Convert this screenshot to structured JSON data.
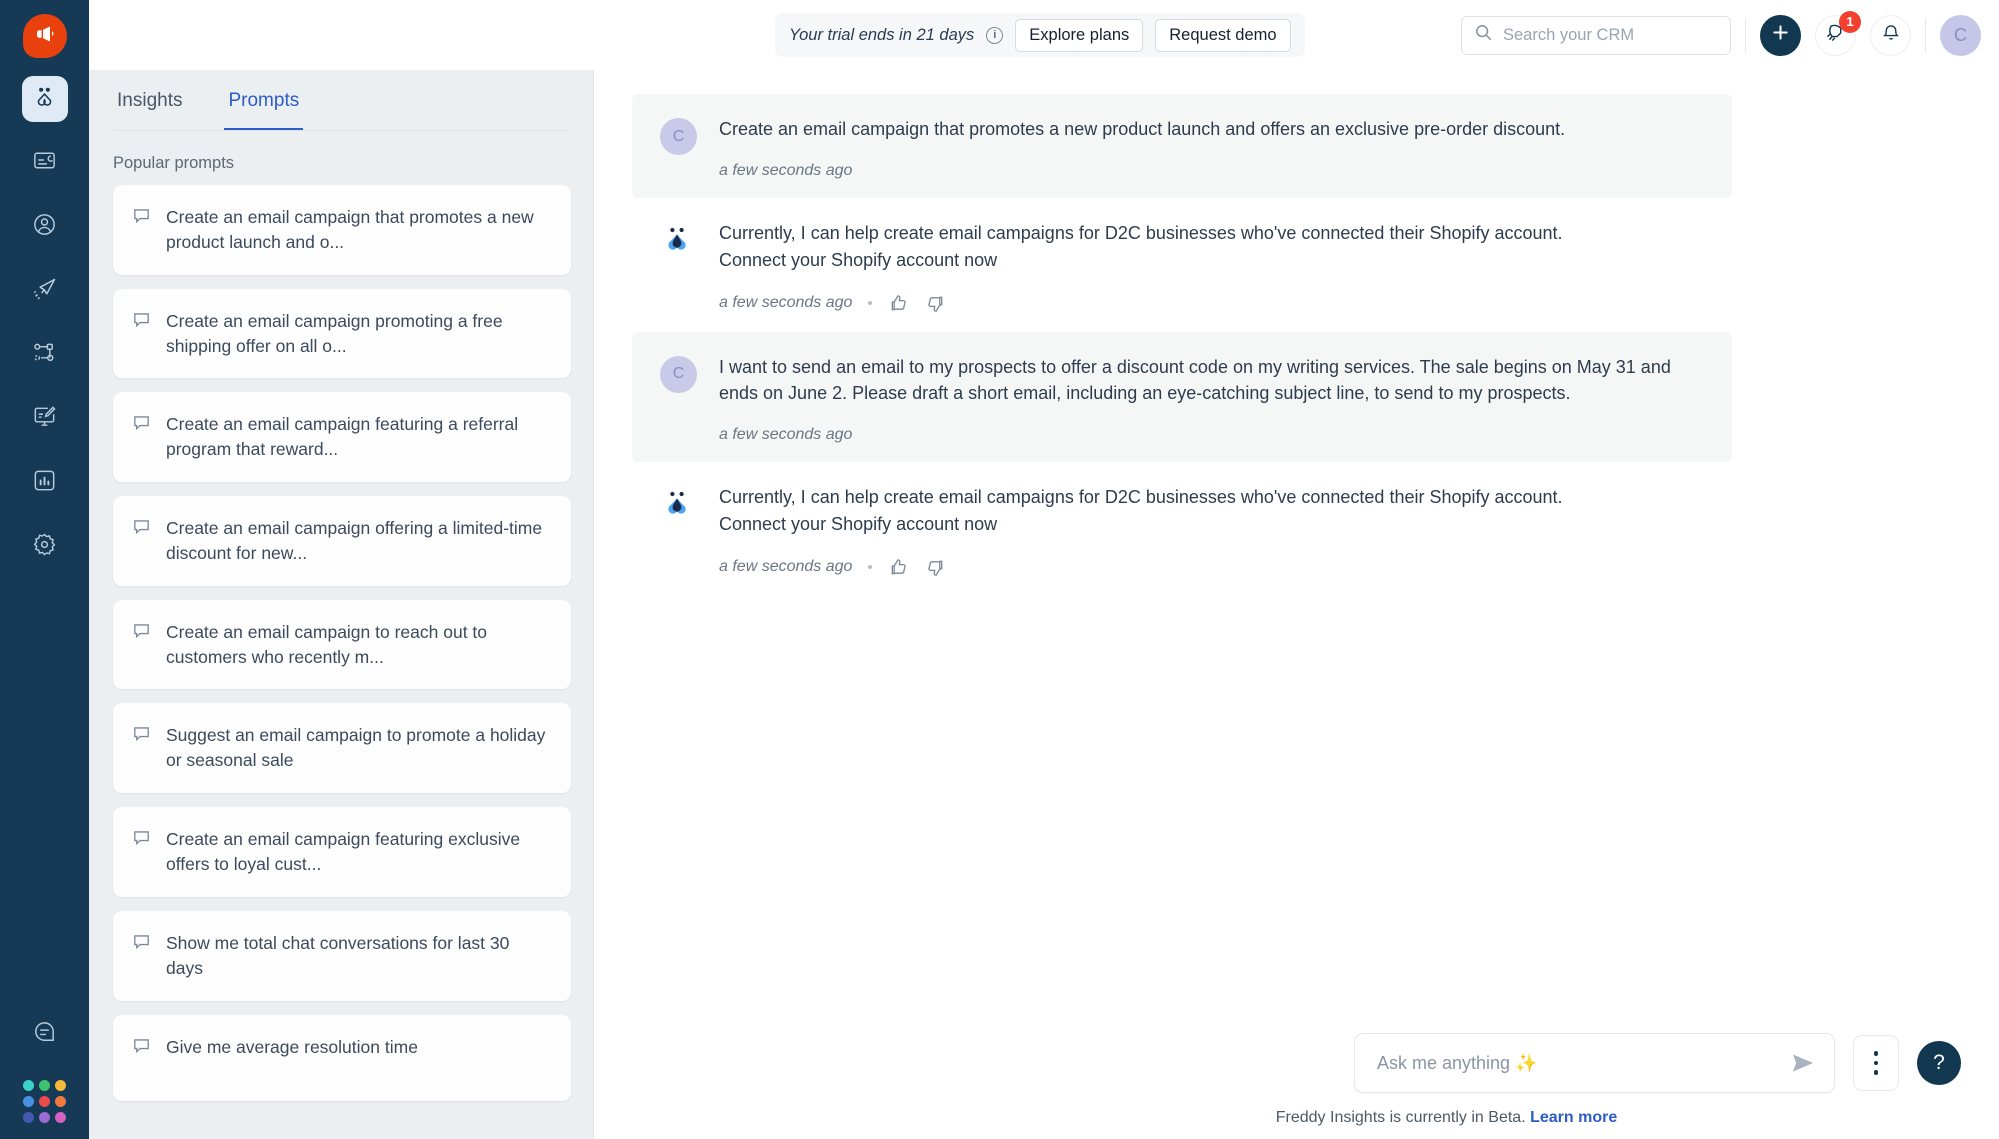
{
  "rail": {
    "logo_icon": "freshworks-megaphone-logo",
    "items": [
      {
        "name": "freddy-ai",
        "icon": "freddy-bot-icon",
        "active": true
      },
      {
        "name": "inbox",
        "icon": "card-inbox-icon",
        "active": false
      },
      {
        "name": "contacts",
        "icon": "person-circle-icon",
        "active": false
      },
      {
        "name": "campaigns",
        "icon": "paper-plane-icon",
        "active": false
      },
      {
        "name": "workflows",
        "icon": "workflow-nodes-icon",
        "active": false
      },
      {
        "name": "web-forms",
        "icon": "monitor-pencil-icon",
        "active": false
      },
      {
        "name": "reports",
        "icon": "bar-chart-icon",
        "active": false
      },
      {
        "name": "settings",
        "icon": "gear-icon",
        "active": false
      }
    ],
    "bottom": [
      {
        "name": "chat-support",
        "icon": "chat-bubble-icon"
      },
      {
        "name": "app-switcher",
        "icon": "dot-grid-icon"
      }
    ],
    "dot_colors": [
      "#3ad5c6",
      "#3fc26b",
      "#f6b93b",
      "#4a90e2",
      "#ec4b4b",
      "#f0793c",
      "#4558b0",
      "#9b6bd6",
      "#d561c0"
    ]
  },
  "header": {
    "trial_text": "Your trial ends in 21 days",
    "info_icon": "info-icon",
    "explore_plans_label": "Explore plans",
    "request_demo_label": "Request demo",
    "search": {
      "placeholder": "Search your CRM",
      "value": "",
      "icon": "search-icon"
    },
    "add_icon": "plus-icon",
    "launch_icon": "rocket-icon",
    "launch_badge": "1",
    "notifications_icon": "bell-icon",
    "avatar_initial": "C"
  },
  "panel": {
    "tabs": [
      {
        "label": "Insights",
        "active": false
      },
      {
        "label": "Prompts",
        "active": true
      }
    ],
    "section_title": "Popular prompts",
    "card_icon": "chat-bubble-icon",
    "prompts": [
      "Create an email campaign that promotes a new product launch and o...",
      "Create an email campaign promoting a free shipping offer on all o...",
      "Create an email campaign featuring a referral program that reward...",
      "Create an email campaign offering a limited-time discount for new...",
      "Create an email campaign to reach out to customers who recently m...",
      "Suggest an email campaign to promote a holiday or seasonal sale",
      "Create an email campaign featuring exclusive offers to loyal cust...",
      "Show me total chat conversations for last 30 days",
      "Give me average resolution time"
    ]
  },
  "chat": {
    "messages": [
      {
        "role": "user",
        "avatar_initial": "C",
        "text": "Create an email campaign that promotes a new product launch and offers an exclusive pre-order discount.",
        "time": "a few seconds ago",
        "has_reactions": false
      },
      {
        "role": "bot",
        "avatar_icon": "freddy-bot-icon",
        "text": "Currently, I can help create email campaigns for D2C businesses who've connected their Shopify account. Connect your Shopify account now",
        "time": "a few seconds ago",
        "has_reactions": true,
        "thumbs_up_icon": "thumbs-up-icon",
        "thumbs_down_icon": "thumbs-down-icon"
      },
      {
        "role": "user",
        "avatar_initial": "C",
        "text": "I want to send an email to my prospects to offer a discount code on my writing services. The sale begins on May 31 and ends on June 2. Please draft a short email, including an eye-catching subject line, to send to my prospects.",
        "time": "a few seconds ago",
        "has_reactions": false
      },
      {
        "role": "bot",
        "avatar_icon": "freddy-bot-icon",
        "text": "Currently, I can help create email campaigns for D2C businesses who've connected their Shopify account. Connect your Shopify account now",
        "time": "a few seconds ago",
        "has_reactions": true,
        "thumbs_up_icon": "thumbs-up-icon",
        "thumbs_down_icon": "thumbs-down-icon"
      }
    ],
    "composer": {
      "placeholder": "Ask me anything ✨",
      "value": "",
      "send_icon": "send-paper-plane-icon",
      "more_icon": "kebab-menu-icon"
    },
    "footer_text": "Freddy Insights is currently in Beta.",
    "footer_link": "Learn more",
    "help_icon": "question-mark-icon"
  },
  "colors": {
    "rail_bg": "#163a56",
    "accent_blue": "#2c5cc5",
    "logo_orange": "#e8410e",
    "badge_red": "#f4402f",
    "panel_bg": "#eceff1"
  }
}
